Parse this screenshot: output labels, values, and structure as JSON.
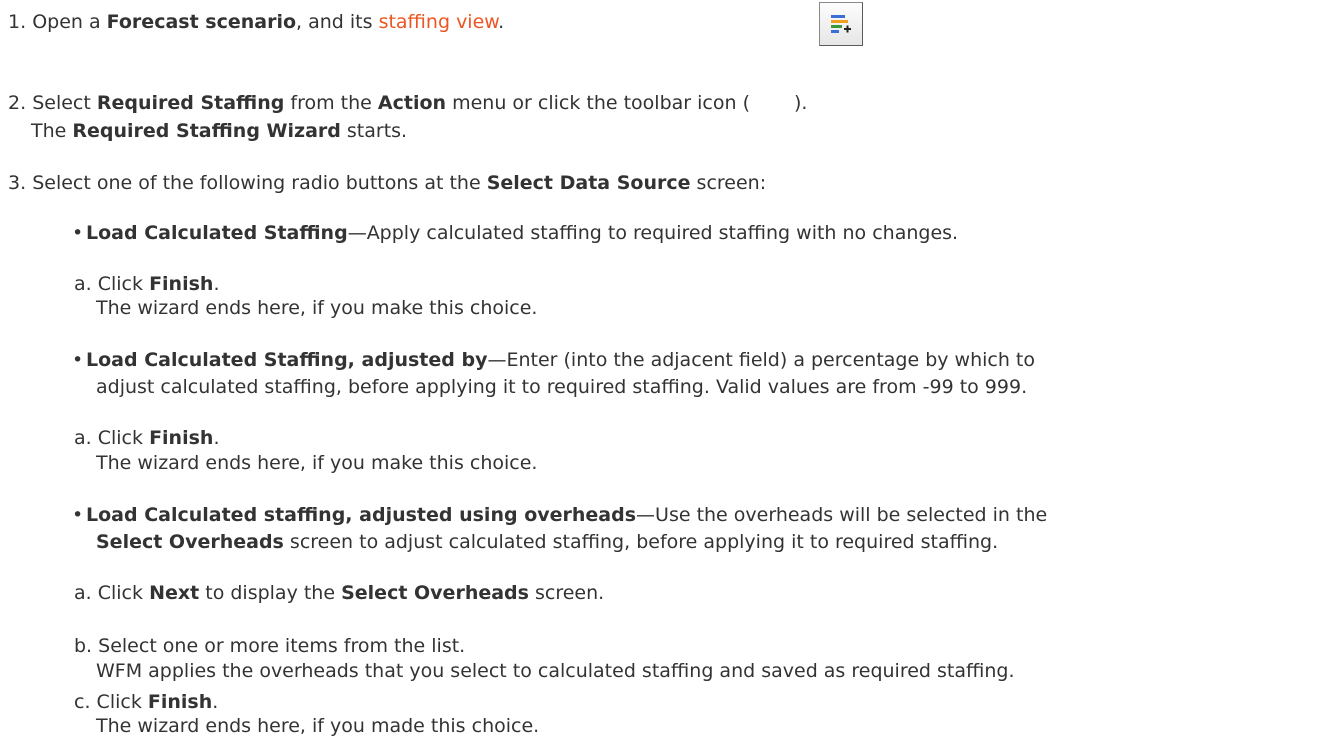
{
  "step1": {
    "num": "1.",
    "t1": "Open a ",
    "b1": "Forecast scenario",
    "t2": ", and its ",
    "link": "staffing view",
    "t3": "."
  },
  "step2": {
    "num": "2.",
    "t1": "Select ",
    "b1": "Required Staffing",
    "t2": " from the ",
    "b2": "Action",
    "t3": " menu or click the toolbar icon (",
    "t4": ").",
    "l2_t1": "The ",
    "l2_b1": "Required Staffing Wizard",
    "l2_t2": " starts.",
    "icon": "add-required-staffing-icon"
  },
  "step3": {
    "num": "3.",
    "t1": "Select one of the following radio buttons at the ",
    "b1": "Select Data Source",
    "t2": " screen:"
  },
  "opt1": {
    "bullet": "•",
    "b1": "Load Calculated Staffing",
    "t1": "—Apply calculated staffing to required staffing with no changes.",
    "a": {
      "num": "a.",
      "t1": "Click ",
      "b1": "Finish",
      "t2": ".",
      "l2": "The wizard ends here, if you make this choice."
    }
  },
  "opt2": {
    "bullet": "•",
    "b1": "Load Calculated Staffing, adjusted by",
    "t1": "—Enter (into the adjacent field) a percentage by which to",
    "l2": "adjust calculated staffing, before applying it to required staffing. Valid values are from -99 to 999.",
    "a": {
      "num": "a.",
      "t1": "Click ",
      "b1": "Finish",
      "t2": ".",
      "l2": "The wizard ends here, if you make this choice."
    }
  },
  "opt3": {
    "bullet": "•",
    "b1": "Load Calculated staffing, adjusted using overheads",
    "t1": "—Use the overheads will be selected in the",
    "l2_b1": "Select Overheads",
    "l2_t1": " screen to adjust calculated staffing, before applying it to required staffing.",
    "a": {
      "num": "a.",
      "t1": "Click ",
      "b1": "Next",
      "t2": " to display the ",
      "b2": "Select Overheads",
      "t3": " screen."
    },
    "b": {
      "num": "b.",
      "t1": "Select one or more items from the list.",
      "l2": "WFM applies the overheads that you select to calculated staffing and saved as required staffing."
    },
    "c": {
      "num": "c.",
      "t1": "Click ",
      "b1": "Finish",
      "t2": ".",
      "l2": "The wizard ends here, if you made this choice."
    }
  }
}
